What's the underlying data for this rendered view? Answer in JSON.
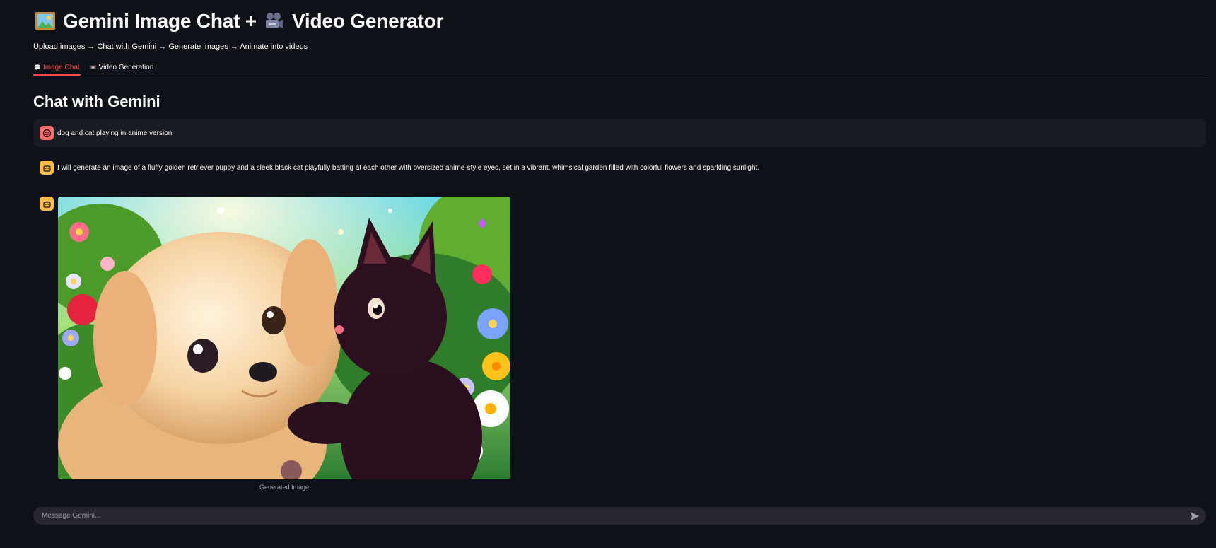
{
  "header": {
    "title": "Gemini Image Chat +",
    "title_part2": "Video Generator",
    "subtitle": "Upload images → Chat with Gemini → Generate images → Animate into videos"
  },
  "tabs": [
    {
      "label": "Image Chat",
      "icon": "speech-bubble-icon",
      "active": true
    },
    {
      "label": "Video Generation",
      "icon": "video-icon",
      "active": false
    }
  ],
  "section_title": "Chat with Gemini",
  "messages": [
    {
      "role": "user",
      "avatar_icon": "user-face-icon",
      "text": "dog and cat playing in anime version"
    },
    {
      "role": "assistant",
      "avatar_icon": "robot-icon",
      "text": "I will generate an image of a fluffy golden retriever puppy and a sleek black cat playfully batting at each other with oversized anime-style eyes, set in a vibrant, whimsical garden filled with colorful flowers and sparkling sunlight."
    },
    {
      "role": "assistant",
      "avatar_icon": "robot-icon",
      "image_caption": "Generated Image"
    }
  ],
  "chat_input": {
    "placeholder": "Message Gemini..."
  },
  "colors": {
    "background": "#0e1117",
    "accent": "#ff4b4b",
    "user_avatar": "#ff6c6c",
    "bot_avatar": "#ffbd45"
  }
}
